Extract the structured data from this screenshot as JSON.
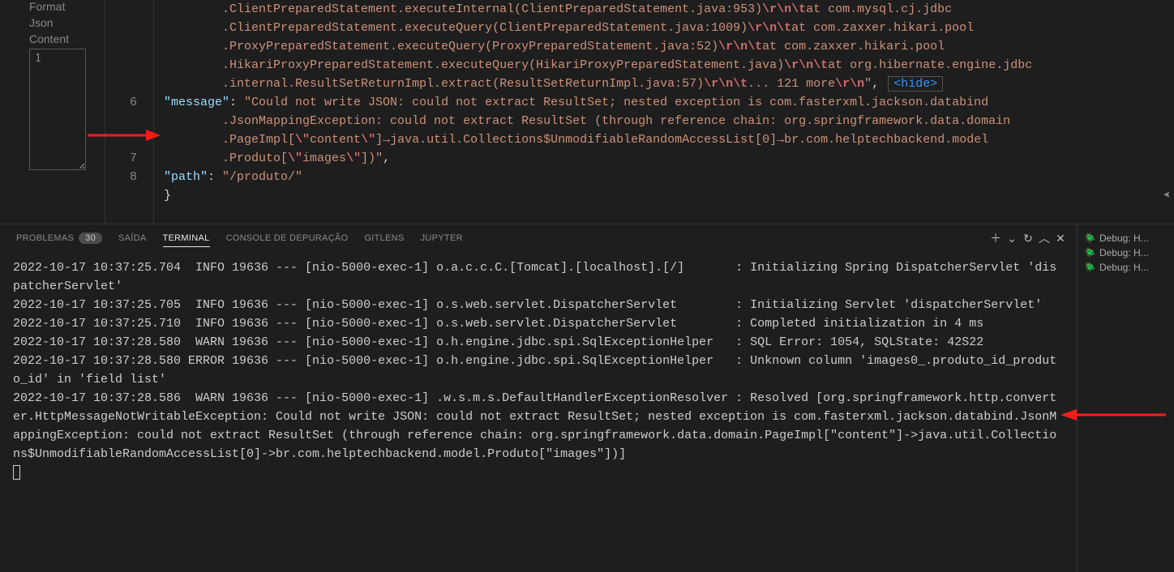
{
  "sidebar": {
    "label1": "Format",
    "label2": "Json",
    "label3": "Content",
    "textarea_value": "1"
  },
  "editor": {
    "lines": [
      "",
      "",
      "",
      "",
      "",
      "6",
      "",
      "",
      "7",
      "8"
    ],
    "trace": {
      "pre1": "        .ClientPreparedStatement.executeInternal(ClientPreparedStatement.java:953)",
      "e1a": "\\r\\n\\t",
      "mid1": "at com.mysql.cj.jdbc",
      "pre2": "        .ClientPreparedStatement.executeQuery(ClientPreparedStatement.java:1009)",
      "e2a": "\\r\\n\\t",
      "mid2": "at com.zaxxer.hikari.pool",
      "pre3": "        .ProxyPreparedStatement.executeQuery(ProxyPreparedStatement.java:52)",
      "e3a": "\\r\\n\\t",
      "mid3": "at com.zaxxer.hikari.pool",
      "pre4": "        .HikariProxyPreparedStatement.executeQuery(HikariProxyPreparedStatement.java)",
      "e4a": "\\r\\n\\t",
      "mid4": "at org.hibernate.engine.jdbc",
      "pre5": "        .internal.ResultSetReturnImpl.extract(ResultSetReturnImpl.java:57)",
      "e5a": "\\r\\n\\t",
      "mid5": "... 121 more",
      "e5b": "\\r\\n",
      "tail5": "\"",
      "hide": "<hide>"
    },
    "message_key": "\"message\"",
    "colon": ": ",
    "message_a": "\"Could not write JSON: could not extract ResultSet; nested exception is com.fasterxml.jackson.databind",
    "message_b": "        .JsonMappingException: could not extract ResultSet (through reference chain: org.springframework.data.domain",
    "message_c1": "        .PageImpl[",
    "message_c2": "\\\"",
    "message_c3": "content",
    "message_c4": "\\\"",
    "message_c5": "]→java.util.Collections$UnmodifiableRandomAccessList[0]→br.com.helptechbackend.model",
    "message_d1": "        .Produto[",
    "message_d2": "\\\"",
    "message_d3": "images",
    "message_d4": "\\\"",
    "message_d5": "])\"",
    "comma": ",",
    "path_key": "\"path\"",
    "path_val": "\"/produto/\"",
    "brace": "}"
  },
  "tabs": {
    "problems": "PROBLEMAS",
    "problems_badge": "30",
    "output": "SAÍDA",
    "terminal": "TERMINAL",
    "debug": "CONSOLE DE DEPURAÇÃO",
    "gitlens": "GITLENS",
    "jupyter": "JUPYTER"
  },
  "terminal_lines": [
    "2022-10-17 10:37:25.704  INFO 19636 --- [nio-5000-exec-1] o.a.c.c.C.[Tomcat].[localhost].[/]       : Initializing Spring DispatcherServlet 'dispatcherServlet'",
    "2022-10-17 10:37:25.705  INFO 19636 --- [nio-5000-exec-1] o.s.web.servlet.DispatcherServlet        : Initializing Servlet 'dispatcherServlet'",
    "2022-10-17 10:37:25.710  INFO 19636 --- [nio-5000-exec-1] o.s.web.servlet.DispatcherServlet        : Completed initialization in 4 ms",
    "2022-10-17 10:37:28.580  WARN 19636 --- [nio-5000-exec-1] o.h.engine.jdbc.spi.SqlExceptionHelper   : SQL Error: 1054, SQLState: 42S22",
    "2022-10-17 10:37:28.580 ERROR 19636 --- [nio-5000-exec-1] o.h.engine.jdbc.spi.SqlExceptionHelper   : Unknown column 'images0_.produto_id_produto_id' in 'field list'",
    "2022-10-17 10:37:28.586  WARN 19636 --- [nio-5000-exec-1] .w.s.m.s.DefaultHandlerExceptionResolver : Resolved [org.springframework.http.converter.HttpMessageNotWritableException: Could not write JSON: could not extract ResultSet; nested exception is com.fasterxml.jackson.databind.JsonMappingException: could not extract ResultSet (through reference chain: org.springframework.data.domain.PageImpl[\"content\"]->java.util.Collections$UnmodifiableRandomAccessList[0]->br.com.helptechbackend.model.Produto[\"images\"])]"
  ],
  "debug_items": [
    "Debug: H...",
    "Debug: H...",
    "Debug: H..."
  ]
}
